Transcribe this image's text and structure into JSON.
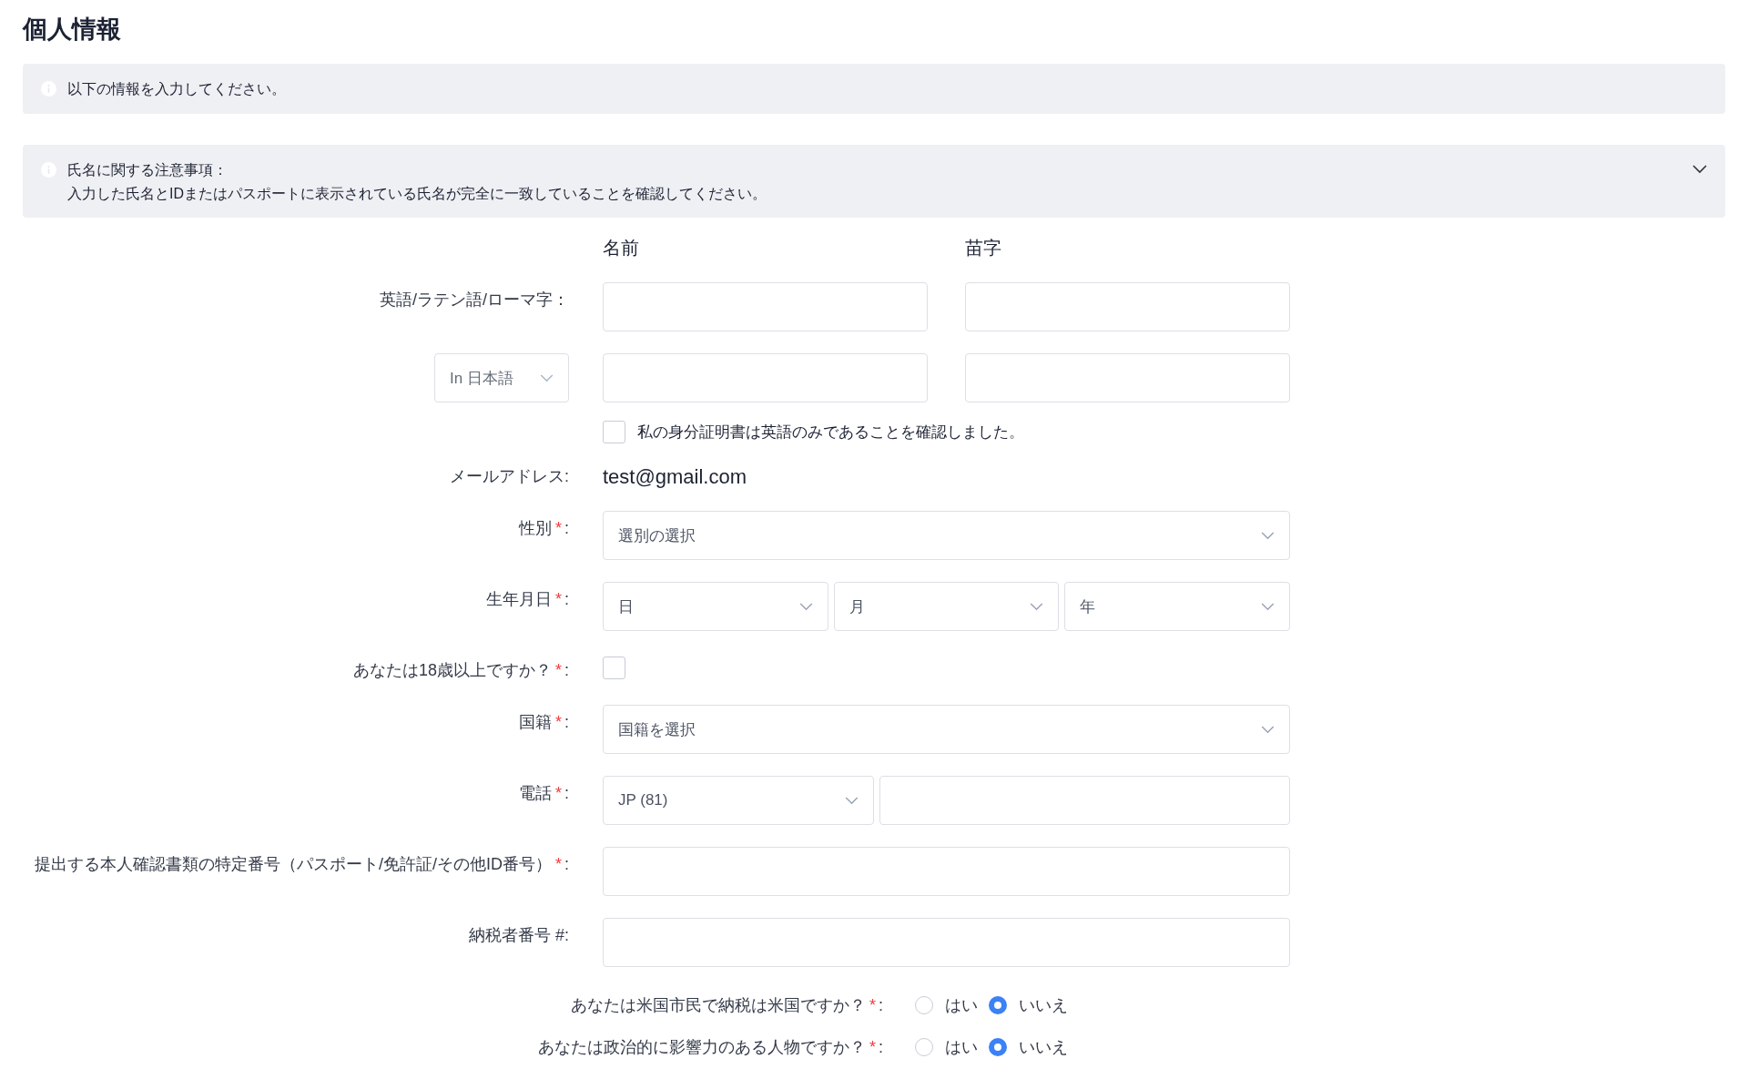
{
  "title": "個人情報",
  "notice": {
    "text": "以下の情報を入力してください。"
  },
  "name_notice": {
    "title": "氏名に関する注意事項：",
    "text": "入力した氏名とIDまたはパスポートに表示されている氏名が完全に一致していることを確認してください。"
  },
  "required_mark": "*",
  "label_colon": ":",
  "name_columns": [
    "名前",
    "苗字"
  ],
  "latin_name": {
    "label": "英語/ラテン語/ローマ字："
  },
  "local_name": {
    "script_select": "In 日本語"
  },
  "english_only_confirm": {
    "label": "私の身分証明書は英語のみであることを確認しました。",
    "checked": false
  },
  "rows": [
    {
      "kind": "email",
      "label": "メールアドレス:",
      "value": "test@gmail.com",
      "required": false
    },
    {
      "kind": "select",
      "label": "性別",
      "required": true,
      "placeholder": "選別の選択"
    },
    {
      "kind": "date",
      "label": "生年月日",
      "required": true,
      "selects": [
        "日",
        "月",
        "年"
      ]
    },
    {
      "kind": "checkbox",
      "label": "あなたは18歳以上ですか？",
      "required": true,
      "checked": false
    },
    {
      "kind": "select",
      "label": "国籍",
      "required": true,
      "placeholder": "国籍を選択"
    },
    {
      "kind": "phone",
      "label": "電話",
      "required": true,
      "code": "JP (81)"
    },
    {
      "kind": "input",
      "label": "提出する本人確認書類の特定番号（パスポート/免許証/その他ID番号）",
      "required": true
    },
    {
      "kind": "input",
      "label": "納税者番号 #:",
      "required": false
    }
  ],
  "questions": [
    {
      "label": "あなたは米国市民で納税は米国ですか？",
      "required": true,
      "options": [
        {
          "label": "はい",
          "selected": false
        },
        {
          "label": "いいえ",
          "selected": true
        }
      ]
    },
    {
      "label": "あなたは政治的に影響力のある人物ですか？",
      "required": true,
      "options": [
        {
          "label": "はい",
          "selected": false
        },
        {
          "label": "いいえ",
          "selected": true
        }
      ]
    }
  ]
}
